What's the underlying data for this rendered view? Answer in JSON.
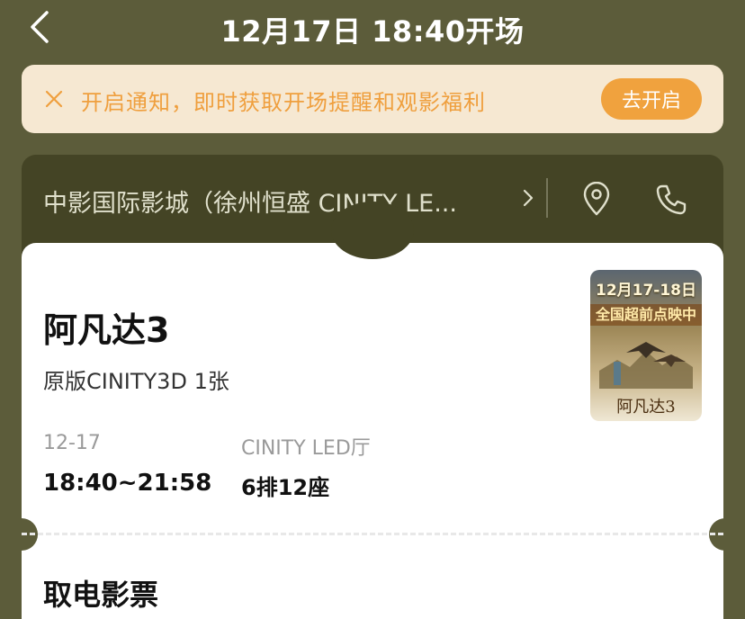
{
  "nav": {
    "title": "12月17日 18:40开场"
  },
  "notice": {
    "text": "开启通知，即时获取开场提醒和观影福利",
    "button_label": "去开启"
  },
  "cinema": {
    "name": "中影国际影城（徐州恒盛 CINITY LE..."
  },
  "ticket": {
    "movie_title": "阿凡达3",
    "format": "原版CINITY3D 1张",
    "date": "12-17",
    "time": "18:40~21:58",
    "hall": "CINITY LED厅",
    "seat": "6排12座"
  },
  "poster": {
    "banner_line": "12月17-18日",
    "banner_sub": "全国超前点映中",
    "title": "阿凡达3"
  },
  "section": {
    "title": "取电影票"
  },
  "colors": {
    "background": "#5c5c3a",
    "accent": "#f0a23e",
    "notice_bg": "#f6e8d2"
  }
}
